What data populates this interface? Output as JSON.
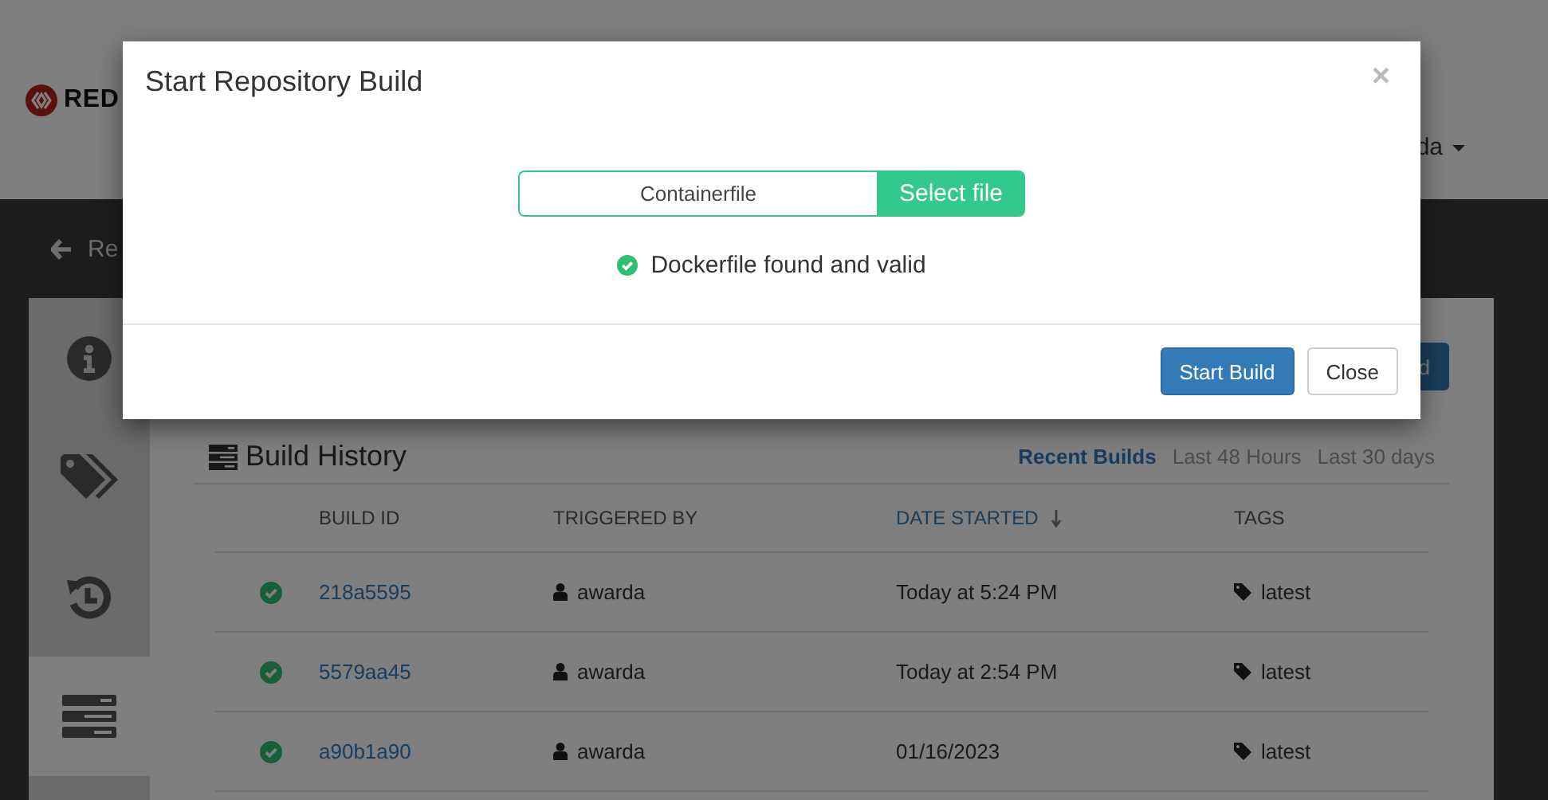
{
  "header": {
    "logo_text": "RED",
    "user_menu": "da"
  },
  "back_link": "Re",
  "sidebar": {
    "items": [
      {
        "kind": "info",
        "selected": false
      },
      {
        "kind": "tags",
        "selected": false
      },
      {
        "kind": "history",
        "selected": false
      },
      {
        "kind": "builds",
        "selected": true
      }
    ]
  },
  "toolbar": {
    "button": "d"
  },
  "build_history": {
    "title": "Build History",
    "filters": [
      {
        "label": "Recent Builds",
        "selected": true
      },
      {
        "label": "Last 48 Hours",
        "selected": false
      },
      {
        "label": "Last 30 days",
        "selected": false
      }
    ],
    "columns": [
      {
        "label": "BUILD ID",
        "sorted": false
      },
      {
        "label": "TRIGGERED BY",
        "sorted": false
      },
      {
        "label": "DATE STARTED",
        "sorted": true
      },
      {
        "label": "TAGS",
        "sorted": false
      }
    ],
    "rows": [
      {
        "build_id": "218a5595",
        "triggered_by": "awarda",
        "date_started": "Today at 5:24 PM",
        "tags": [
          "latest"
        ]
      },
      {
        "build_id": "5579aa45",
        "triggered_by": "awarda",
        "date_started": "Today at 2:54 PM",
        "tags": [
          "latest"
        ]
      },
      {
        "build_id": "a90b1a90",
        "triggered_by": "awarda",
        "date_started": "01/16/2023",
        "tags": [
          "latest"
        ]
      }
    ]
  },
  "modal": {
    "title": "Start Repository Build",
    "close": "×",
    "file_field": {
      "value": "Containerfile",
      "button": "Select file"
    },
    "message": "Dockerfile found and valid",
    "buttons": [
      {
        "label": "Start Build",
        "kind": "primary"
      },
      {
        "label": "Close",
        "kind": "default"
      }
    ]
  }
}
